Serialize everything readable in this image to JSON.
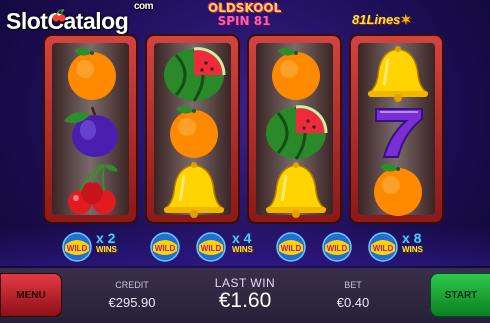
{
  "watermark": {
    "text": "SlotCatalog",
    "suffix": "com"
  },
  "logo": {
    "line1": "OLDSKOOL",
    "line2": "SPIN",
    "line3": "81"
  },
  "lines_badge": {
    "text": "81Lines"
  },
  "reels": [
    [
      "orange",
      "plum",
      "cherry"
    ],
    [
      "watermelon",
      "orange",
      "bell"
    ],
    [
      "orange",
      "watermelon",
      "bell"
    ],
    [
      "bell",
      "seven",
      "orange"
    ]
  ],
  "multipliers": [
    {
      "text": "x 2",
      "win": "WINS"
    },
    {
      "text": "x 4",
      "win": "WINS"
    },
    {
      "text": "x 8",
      "win": "WINS"
    }
  ],
  "wild_label": "WILD",
  "controls": {
    "menu_label": "MENU",
    "start_label": "START",
    "credit_label": "CREDIT",
    "credit_value": "€295.90",
    "last_win_label": "LAST WIN",
    "last_win_value": "€1.60",
    "bet_label": "BET",
    "bet_value": "€0.40"
  },
  "colors": {
    "reel_frame": "#c2332f",
    "menu_button": "#d42a35",
    "start_button": "#1fae3a",
    "background": "#1c0e55"
  }
}
